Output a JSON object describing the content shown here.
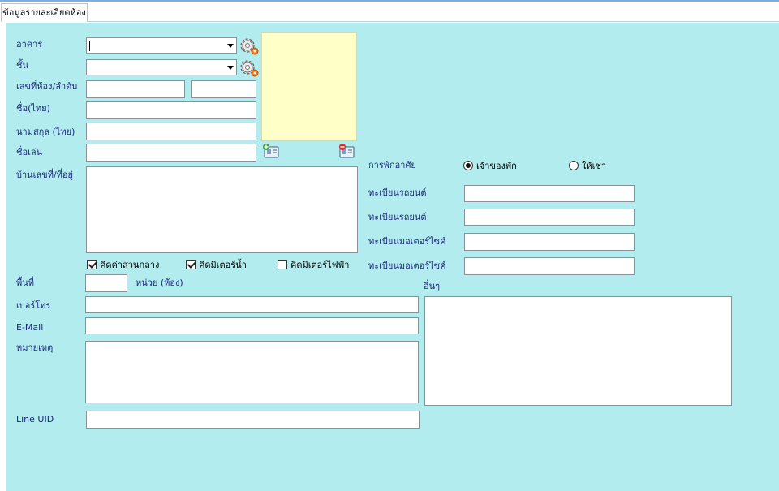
{
  "tab": {
    "label": "ข้อมูลรายละเอียดห้อง"
  },
  "form": {
    "building_label": "อาคาร",
    "building_value": "",
    "floor_label": "ชั้น",
    "floor_value": "",
    "room_no_label": "เลขที่ห้อง/ลำดับ",
    "room_no_value": "",
    "room_seq_value": "",
    "first_name_label": "ชื่อ(ไทย)",
    "first_name_value": "",
    "last_name_label": "นามสกุล (ไทย)",
    "last_name_value": "",
    "nickname_label": "ชื่อเล่น",
    "nickname_value": "",
    "address_label": "บ้านเลขที่/ที่อยู่",
    "address_value": "",
    "area_label": "พื้นที่",
    "area_value": "",
    "unit_label": "หน่วย (ห้อง)",
    "phone_label": "เบอร์โทร",
    "phone_value": "",
    "email_label": "E-Mail",
    "email_value": "",
    "note_label": "หมายเหตุ",
    "note_value": "",
    "line_uid_label": "Line UID",
    "line_uid_value": "",
    "other_label": "อื่นๆ",
    "other_value": ""
  },
  "checks": [
    {
      "label": "คิดค่าส่วนกลาง",
      "checked": true
    },
    {
      "label": "คิดมิเตอร์น้ำ",
      "checked": true
    },
    {
      "label": "คิดมิเตอร์ไฟฟ้า",
      "checked": false
    }
  ],
  "residence": {
    "label": "การพักอาศัย",
    "owner_label": "เจ้าของพัก",
    "owner_selected": true,
    "rent_label": "ให้เช่า",
    "rent_selected": false
  },
  "vehicles": {
    "car1_label": "ทะเบียนรถยนต์",
    "car1_value": "",
    "car2_label": "ทะเบียนรถยนต์",
    "car2_value": "",
    "moto1_label": "ทะเบียนมอเตอร์ไซค์",
    "moto1_value": "",
    "moto2_label": "ทะเบียนมอเตอร์ไซค์",
    "moto2_value": ""
  },
  "colors": {
    "panel": "#b2ecee",
    "label": "#1b2a7a",
    "photo": "#ffffc8"
  }
}
